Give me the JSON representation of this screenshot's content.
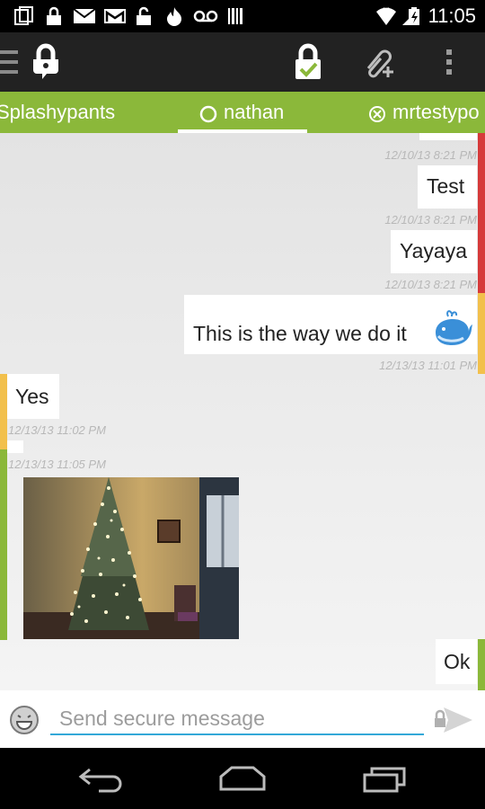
{
  "status_bar": {
    "time": "11:05",
    "left_icons": [
      "screenshot-icon",
      "lock-icon",
      "mail-icon",
      "gmail-icon",
      "unlock-icon",
      "flame-icon",
      "voicemail-icon",
      "barcode-icon"
    ],
    "right_icons": [
      "wifi-icon",
      "signal-icon",
      "battery-icon"
    ]
  },
  "action_bar": {
    "icons": [
      "drawer-menu-icon",
      "app-lock-icon",
      "secure-lock-icon",
      "attach-icon",
      "overflow-menu-icon"
    ]
  },
  "tabs": [
    {
      "label": "Splashypants",
      "status": "none"
    },
    {
      "label": "nathan",
      "status": "online",
      "active": true
    },
    {
      "label": "mrtestypo",
      "status": "offline"
    }
  ],
  "messages": [
    {
      "direction": "out",
      "text": "",
      "timestamp": "12/10/13 8:21 PM",
      "accent": "#d63a3a"
    },
    {
      "direction": "out",
      "text": "Test",
      "timestamp": "12/10/13 8:21 PM",
      "accent": "#d63a3a"
    },
    {
      "direction": "out",
      "text": "Yayaya",
      "timestamp": "12/10/13 8:21 PM",
      "accent": "#d63a3a"
    },
    {
      "direction": "out",
      "text": "This is the way we do it",
      "emoji": "whale-icon",
      "timestamp": "12/13/13 11:01 PM",
      "accent": "#f2c04c"
    },
    {
      "direction": "in",
      "text": "Yes",
      "timestamp": "12/13/13 11:02 PM",
      "accent": "#f2c04c"
    },
    {
      "direction": "in",
      "text": "",
      "image": "christmas-tree-photo",
      "timestamp": "12/13/13 11:05 PM",
      "accent": "#8bb83a"
    },
    {
      "direction": "out",
      "text": "Ok",
      "timestamp": "",
      "accent": "#8bb83a"
    }
  ],
  "composer": {
    "placeholder": "Send secure message",
    "value": ""
  },
  "nav_bar": {
    "icons": [
      "back-icon",
      "home-icon",
      "recents-icon"
    ]
  },
  "colors": {
    "tab_strip": "#8bb83a",
    "accent_red": "#d63a3a",
    "accent_yellow": "#f2c04c",
    "accent_green": "#8bb83a",
    "input_underline": "#33a8d8"
  }
}
